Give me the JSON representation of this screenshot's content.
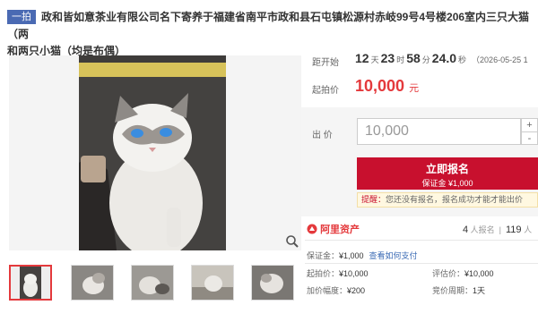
{
  "title": {
    "tag": "一拍",
    "line1": "政和皆如意茶业有限公司名下寄养于福建省南平市政和县石屯镇松源村赤岐99号4号楼206室内三只大猫（两",
    "line2": "和两只小猫（均是布偶）"
  },
  "countdown": {
    "label": "距开始",
    "days": "12",
    "days_unit": "天",
    "hours": "23",
    "hours_unit": "时",
    "minutes": "58",
    "minutes_unit": "分",
    "seconds": "24.0",
    "seconds_unit": "秒",
    "start_date": "（2026-05-25 1"
  },
  "start_price": {
    "label": "起拍价",
    "value": "10,000",
    "unit": "元"
  },
  "bid": {
    "label": "出 价",
    "value": "10,000",
    "plus": "+",
    "minus": "-",
    "signup_label": "立即报名",
    "deposit_label": "保证金 ¥1,000",
    "tip_label": "提醒：",
    "tip_text": "您还没有报名，报名成功才能才能出价"
  },
  "platform": {
    "logo": "阿里资产",
    "count1": "4",
    "count1_label": "人报名",
    "count2": "119",
    "count2_label": "人"
  },
  "info": {
    "deposit_label": "保证金：",
    "deposit_value": "¥1,000",
    "deposit_link": "查看如何支付",
    "start_label": "起拍价：",
    "start_value": "¥10,000",
    "eval_label": "评估价：",
    "eval_value": "¥10,000",
    "step_label": "加价幅度：",
    "step_value": "¥200",
    "period_label": "竞价周期：",
    "period_value": "1天"
  },
  "icons": [
    "zoom-icon",
    "ali-logo-icon"
  ],
  "colors": {
    "accent": "#e4393c",
    "button": "#c8102e",
    "tag": "#4a6ab3",
    "link": "#3b6bb5"
  }
}
